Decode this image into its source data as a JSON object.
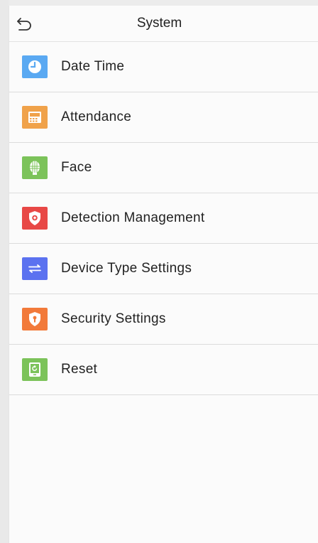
{
  "header": {
    "title": "System",
    "back_icon": "back-arrow-icon"
  },
  "menu": {
    "items": [
      {
        "label": "Date Time",
        "icon": "clock-icon",
        "color": "#5aa9f2"
      },
      {
        "label": "Attendance",
        "icon": "attendance-device-icon",
        "color": "#f0a24a"
      },
      {
        "label": "Face",
        "icon": "face-scan-icon",
        "color": "#7cc35a"
      },
      {
        "label": "Detection Management",
        "icon": "shield-alert-icon",
        "color": "#e84846"
      },
      {
        "label": "Device Type Settings",
        "icon": "switch-arrows-icon",
        "color": "#5b72f0"
      },
      {
        "label": "Security Settings",
        "icon": "security-shield-icon",
        "color": "#f27a3a"
      },
      {
        "label": "Reset",
        "icon": "reset-device-icon",
        "color": "#7cc35a"
      }
    ]
  }
}
